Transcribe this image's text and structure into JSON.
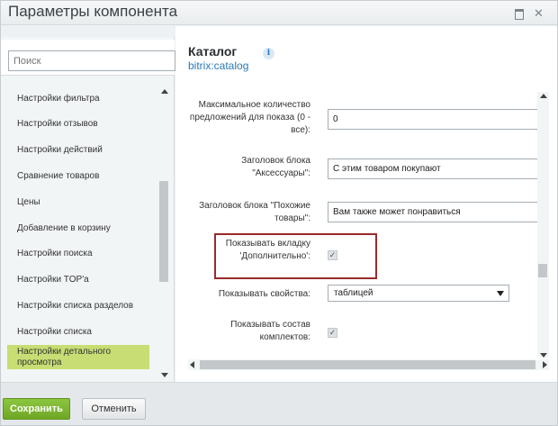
{
  "window": {
    "title": "Параметры компонента"
  },
  "sidebar": {
    "search_placeholder": "Поиск",
    "items": [
      {
        "label": "Настройки фильтра"
      },
      {
        "label": "Настройки отзывов"
      },
      {
        "label": "Настройки действий"
      },
      {
        "label": "Сравнение товаров"
      },
      {
        "label": "Цены"
      },
      {
        "label": "Добавление в корзину"
      },
      {
        "label": "Настройки поиска"
      },
      {
        "label": "Настройки TOP'а"
      },
      {
        "label": "Настройки списка разделов"
      },
      {
        "label": "Настройки списка"
      },
      {
        "label": "Настройки детального просмотра",
        "active": true
      }
    ]
  },
  "component": {
    "title": "Каталог",
    "id": "bitrix:catalog",
    "info_icon": "i"
  },
  "props": [
    {
      "label": "Максимальное количество предложений для показа (0 - все):",
      "value": "0"
    },
    {
      "label": "Заголовок блока \"Аксессуары\":",
      "value": "С этим товаром покупают"
    },
    {
      "label": "Заголовок блока \"Похожие товары\":",
      "value": "Вам также может понравиться"
    },
    {
      "label": "Показывать вкладку 'Дополнительно':",
      "checked": true
    },
    {
      "label": "Показывать свойства:",
      "value": "таблицей"
    },
    {
      "label": "Показывать состав комплектов:",
      "checked": true
    }
  ],
  "checkbox_mark": "✓",
  "footer": {
    "save": "Сохранить",
    "cancel": "Отменить"
  },
  "colors": {
    "accent_green": "#8cc63f",
    "link_blue": "#2b79b8",
    "highlight_red": "#9a2a2a",
    "active_item": "#c8dd73"
  }
}
